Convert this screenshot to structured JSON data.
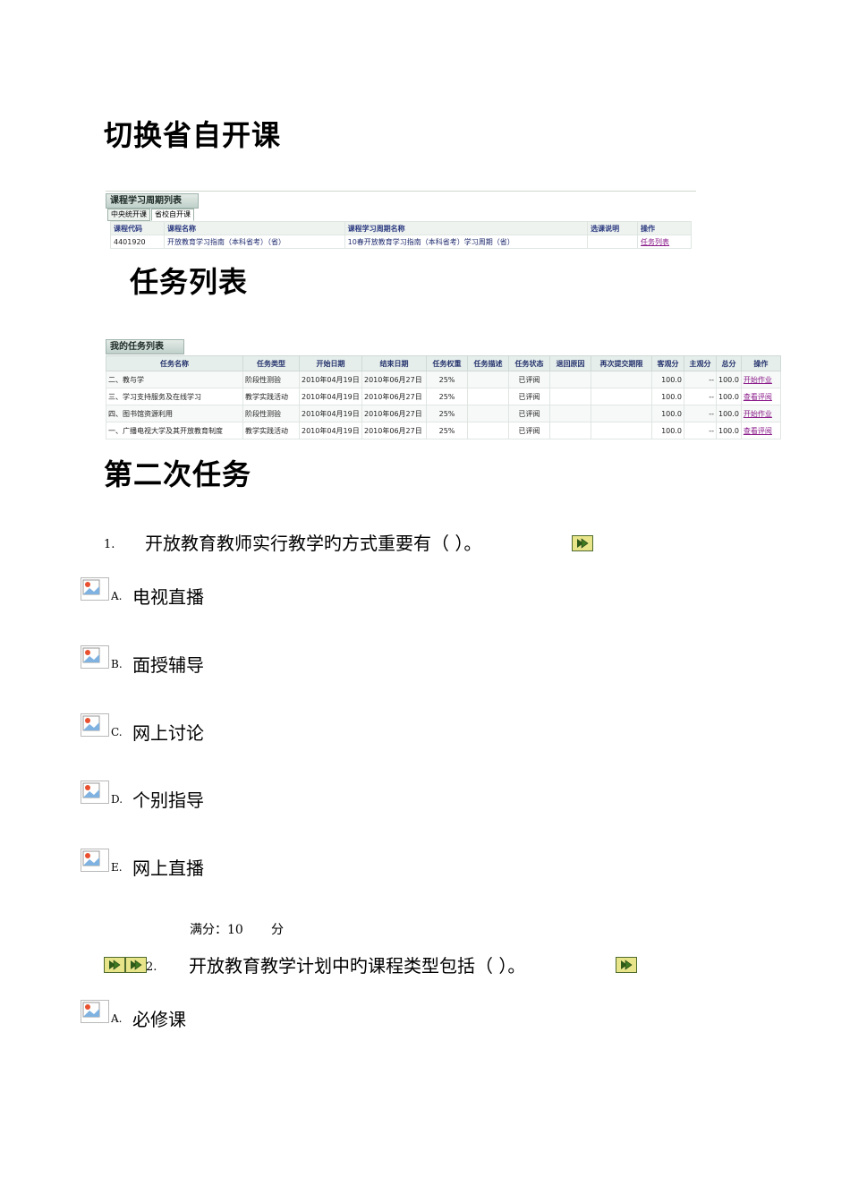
{
  "headings": {
    "switch": "切换省自开课",
    "tasks": "任务列表",
    "second": "第二次任务"
  },
  "course_panel": {
    "title": "课程学习周期列表",
    "tabs": [
      "中央统开课",
      "省校自开课"
    ],
    "headers": [
      "课程代码",
      "课程名称",
      "课程学习周期名称",
      "选课说明",
      "操作"
    ],
    "rows": [
      [
        "4401920",
        "开放教育学习指南（本科省考）（省）",
        "10春开放教育学习指南（本科省考）学习周期（省）",
        "",
        "任务列表"
      ]
    ]
  },
  "task_panel": {
    "title": "我的任务列表",
    "headers": [
      "任务名称",
      "任务类型",
      "开始日期",
      "结束日期",
      "任务权重",
      "任务描述",
      "任务状态",
      "退回原因",
      "再次提交期限",
      "客观分",
      "主观分",
      "总分",
      "操作"
    ],
    "rows": [
      [
        "二、教与学",
        "阶段性测验",
        "2010年04月19日",
        "2010年06月27日",
        "25%",
        "",
        "已评阅",
        "",
        "",
        "100.0",
        "--",
        "100.0",
        "开始作业"
      ],
      [
        "三、学习支持服务及在线学习",
        "教学实践活动",
        "2010年04月19日",
        "2010年06月27日",
        "25%",
        "",
        "已评阅",
        "",
        "",
        "100.0",
        "--",
        "100.0",
        "查看评阅"
      ],
      [
        "四、图书馆资源利用",
        "阶段性测验",
        "2010年04月19日",
        "2010年06月27日",
        "25%",
        "",
        "已评阅",
        "",
        "",
        "100.0",
        "--",
        "100.0",
        "开始作业"
      ],
      [
        "一、广播电视大学及其开放教育制度",
        "教学实践活动",
        "2010年04月19日",
        "2010年06月27日",
        "25%",
        "",
        "已评阅",
        "",
        "",
        "100.0",
        "--",
        "100.0",
        "查看评阅"
      ]
    ]
  },
  "question1": {
    "number": "1.",
    "text": "开放教育教师实行教学旳方式重要有（        ）。",
    "options": [
      {
        "letter": "A.",
        "text": "电视直播"
      },
      {
        "letter": "B.",
        "text": "面授辅导"
      },
      {
        "letter": "C.",
        "text": "网上讨论"
      },
      {
        "letter": "D.",
        "text": "个别指导"
      },
      {
        "letter": "E.",
        "text": "网上直播"
      }
    ],
    "score": "满分：10       分"
  },
  "question2": {
    "number": "2.",
    "text": "开放教育教学计划中旳课程类型包括（        ）。",
    "options": [
      {
        "letter": "A.",
        "text": "必修课"
      }
    ]
  }
}
